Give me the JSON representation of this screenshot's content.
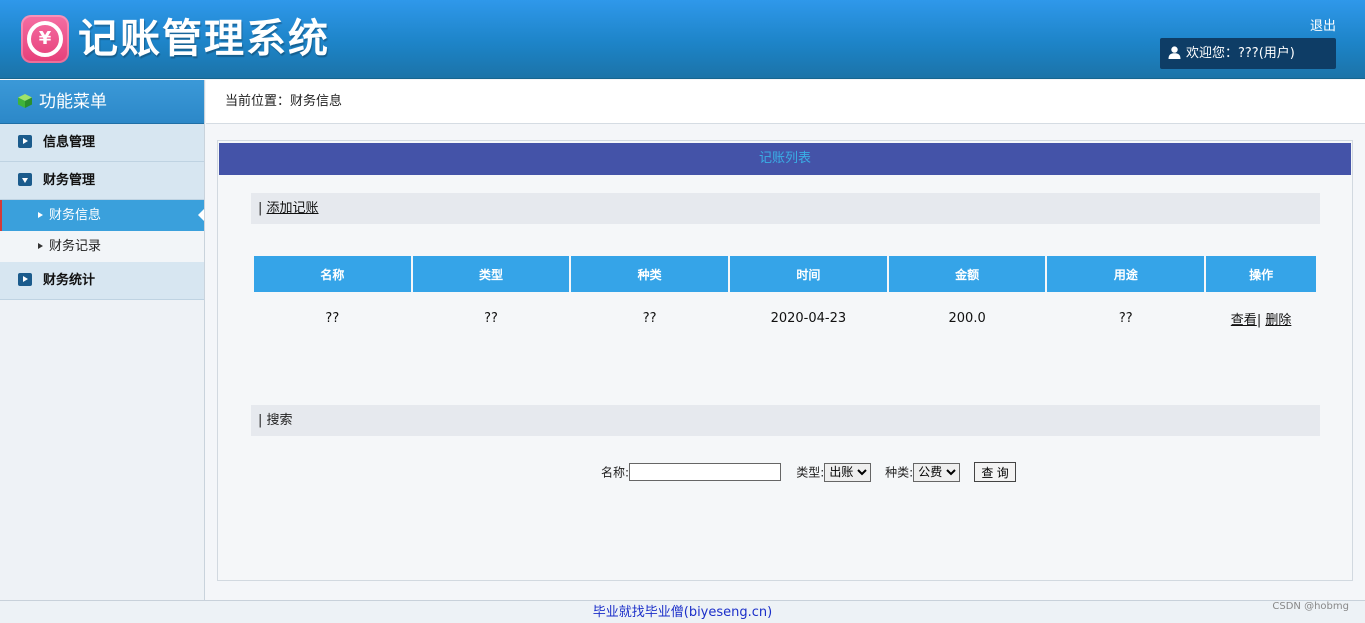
{
  "header": {
    "logo_glyph": "¥",
    "title": "记账管理系统",
    "logout": "退出",
    "welcome": "欢迎您：???(用户)"
  },
  "sidebar": {
    "title": "功能菜单",
    "items": [
      {
        "label": "信息管理",
        "icon": "arrow-right-icon"
      },
      {
        "label": "财务管理",
        "icon": "arrow-down-icon"
      },
      {
        "label": "财务统计",
        "icon": "arrow-right-icon"
      }
    ],
    "sub_items": [
      {
        "label": "财务信息",
        "active": true
      },
      {
        "label": "财务记录",
        "active": false
      }
    ]
  },
  "breadcrumb": "当前位置：财务信息",
  "panel": {
    "title": "记账列表",
    "add_prefix": "| ",
    "add_link": "添加记账",
    "search_title": "| 搜索"
  },
  "table": {
    "headers": [
      "名称",
      "类型",
      "种类",
      "时间",
      "金额",
      "用途",
      "操作"
    ],
    "rows": [
      {
        "name": "??",
        "type": "??",
        "kind": "??",
        "time": "2020-04-23",
        "amount": "200.0",
        "usage": "??",
        "view": "查看",
        "sep": "|",
        "delete": "删除"
      }
    ]
  },
  "search": {
    "name_label": "名称:",
    "name_value": "",
    "type_label": "类型:",
    "type_selected": "出账",
    "kind_label": "种类:",
    "kind_selected": "公费",
    "submit": "查 询"
  },
  "footer": {
    "link": "毕业就找毕业僧(biyeseng.cn)",
    "watermark": "CSDN @hobmg"
  },
  "colors": {
    "header_blue": "#2f98ea",
    "panel_title_bg": "#4453a8",
    "table_header_bg": "#35a4e8",
    "active_menu_bg": "#3aa0dc"
  }
}
